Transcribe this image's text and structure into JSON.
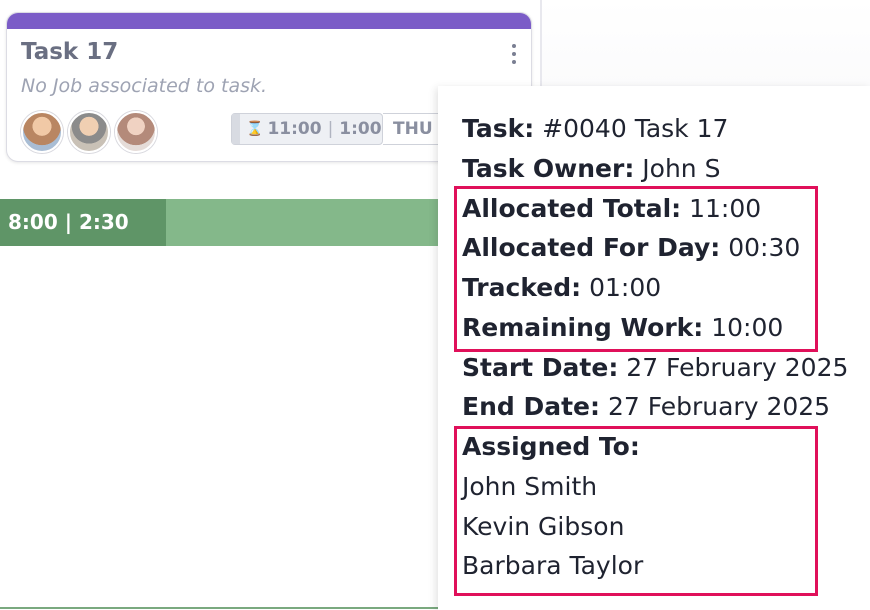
{
  "task_card": {
    "title": "Task 17",
    "subtitle": "No Job associated to task.",
    "time_allocated": "11:00",
    "time_tracked": "1:00",
    "time_separator": "|",
    "day_label": "THU",
    "avatars": [
      {
        "icon": "avatar-photo"
      },
      {
        "icon": "avatar-photo"
      },
      {
        "icon": "avatar-photo"
      }
    ],
    "accent_color": "#7b5cc7"
  },
  "day_bar": {
    "label": "8:00 | 2:30",
    "color": "#84b88a"
  },
  "tooltip": {
    "task": {
      "label": "Task:",
      "value": "#0040 Task 17"
    },
    "owner": {
      "label": "Task Owner:",
      "value": "John S"
    },
    "allocated_total": {
      "label": "Allocated Total:",
      "value": "11:00"
    },
    "allocated_day": {
      "label": "Allocated For Day:",
      "value": "00:30"
    },
    "tracked": {
      "label": "Tracked:",
      "value": "01:00"
    },
    "remaining": {
      "label": "Remaining Work:",
      "value": "10:00"
    },
    "start_date": {
      "label": "Start Date:",
      "value": "27 February 2025"
    },
    "end_date": {
      "label": "End Date:",
      "value": "27 February 2025"
    },
    "assigned_label": "Assigned To:",
    "assignees": [
      "John Smith",
      "Kevin Gibson",
      "Barbara Taylor"
    ],
    "highlight_color": "#e0105a"
  }
}
